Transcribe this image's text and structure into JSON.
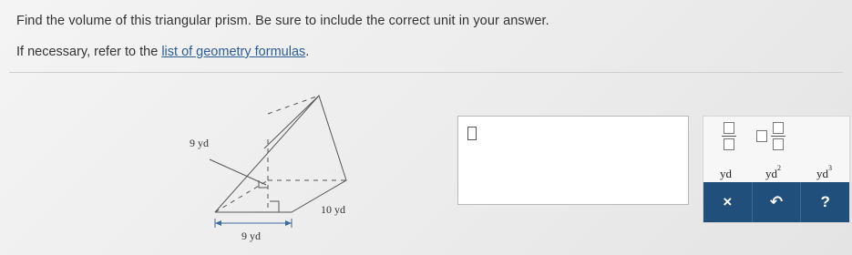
{
  "question": {
    "text": "Find the volume of this triangular prism. Be sure to include the correct unit in your answer."
  },
  "help": {
    "prefix": "If necessary, refer to the ",
    "link": "list of geometry formulas",
    "suffix": "."
  },
  "figure": {
    "label_height": "9 yd",
    "label_length": "10 yd",
    "label_base": "9 yd"
  },
  "answer": {
    "value": ""
  },
  "keypad": {
    "unit_1": "yd",
    "unit_2_base": "yd",
    "unit_2_exp": "2",
    "unit_3_base": "yd",
    "unit_3_exp": "3",
    "clear_symbol": "×",
    "undo_symbol": "↶",
    "help_symbol": "?",
    "icons": [
      "fraction-icon",
      "mixed-number-icon",
      "clear-icon",
      "undo-icon",
      "help-icon"
    ]
  }
}
